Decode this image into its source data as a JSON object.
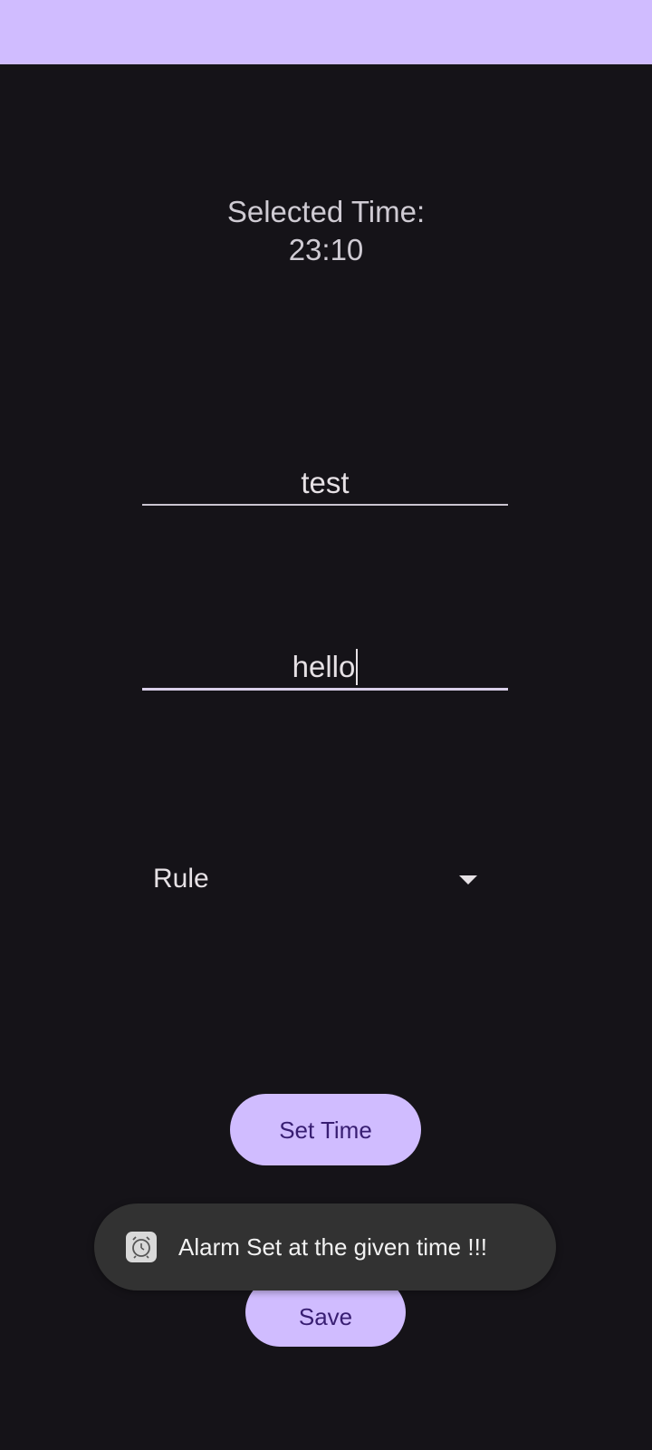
{
  "selected_time": {
    "label": "Selected Time:",
    "value": "23:10"
  },
  "fields": {
    "first_value": "test",
    "second_value": "hello"
  },
  "spinner": {
    "selected": "Rule",
    "icon": "dropdown-arrow-icon"
  },
  "buttons": {
    "set_time": "Set Time",
    "save": "Save"
  },
  "toast": {
    "message": "Alarm Set at the given time !!!",
    "icon": "alarm-clock-icon"
  },
  "colors": {
    "accent": "#d0bcff",
    "background": "#151318",
    "button_text": "#381e72",
    "toast_bg": "#323232"
  }
}
